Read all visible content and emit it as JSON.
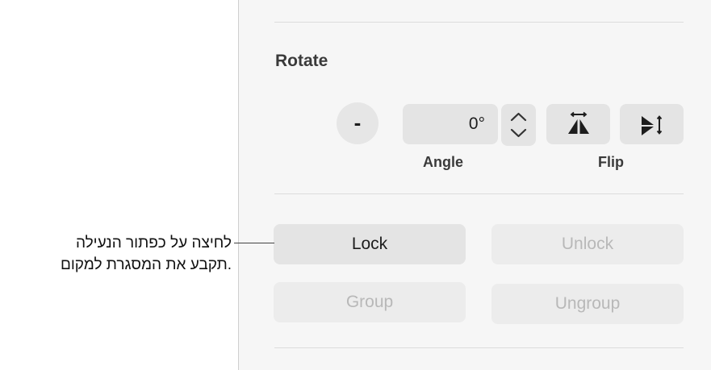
{
  "rotate": {
    "title": "Rotate",
    "minus_label": "-",
    "angle_value": "0°",
    "angle_label": "Angle",
    "flip_label": "Flip"
  },
  "buttons": {
    "lock": "Lock",
    "unlock": "Unlock",
    "group": "Group",
    "ungroup": "Ungroup"
  },
  "callout": {
    "line1": "לחיצה על כפתור הנעילה",
    "line2": "תקבע את המסגרת למקום."
  }
}
